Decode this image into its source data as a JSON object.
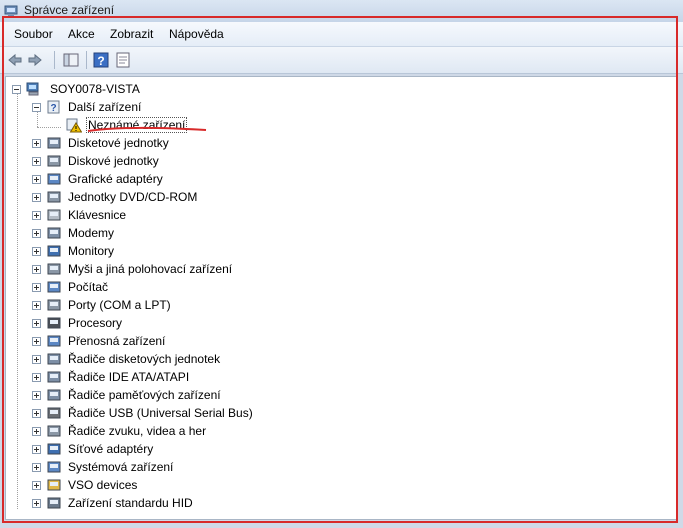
{
  "window": {
    "title": "Správce zařízení"
  },
  "menu": [
    "Soubor",
    "Akce",
    "Zobrazit",
    "Nápověda"
  ],
  "toolbar": {
    "back_icon": "back-arrow-icon",
    "forward_icon": "forward-arrow-icon",
    "console_tree_icon": "console-tree-icon",
    "help_icon": "help-icon",
    "properties_icon": "properties-icon"
  },
  "tree": {
    "root": "SOY0078-VISTA",
    "other_devices": {
      "label": "Další zařízení",
      "children": [
        "Neznámé zařízení"
      ]
    },
    "categories": [
      "Disketové jednotky",
      "Diskové jednotky",
      "Grafické adaptéry",
      "Jednotky DVD/CD-ROM",
      "Klávesnice",
      "Modemy",
      "Monitory",
      "Myši a jiná polohovací zařízení",
      "Počítač",
      "Porty (COM a LPT)",
      "Procesory",
      "Přenosná zařízení",
      "Řadiče disketových jednotek",
      "Řadiče IDE ATA/ATAPI",
      "Řadiče paměťových zařízení",
      "Řadiče USB (Universal Serial Bus)",
      "Řadiče zvuku, videa a her",
      "Síťové adaptéry",
      "Systémová zařízení",
      "VSO devices",
      "Zařízení standardu HID"
    ]
  },
  "colors": {
    "annotation": "#d82a2a",
    "warning": "#f2c200"
  }
}
